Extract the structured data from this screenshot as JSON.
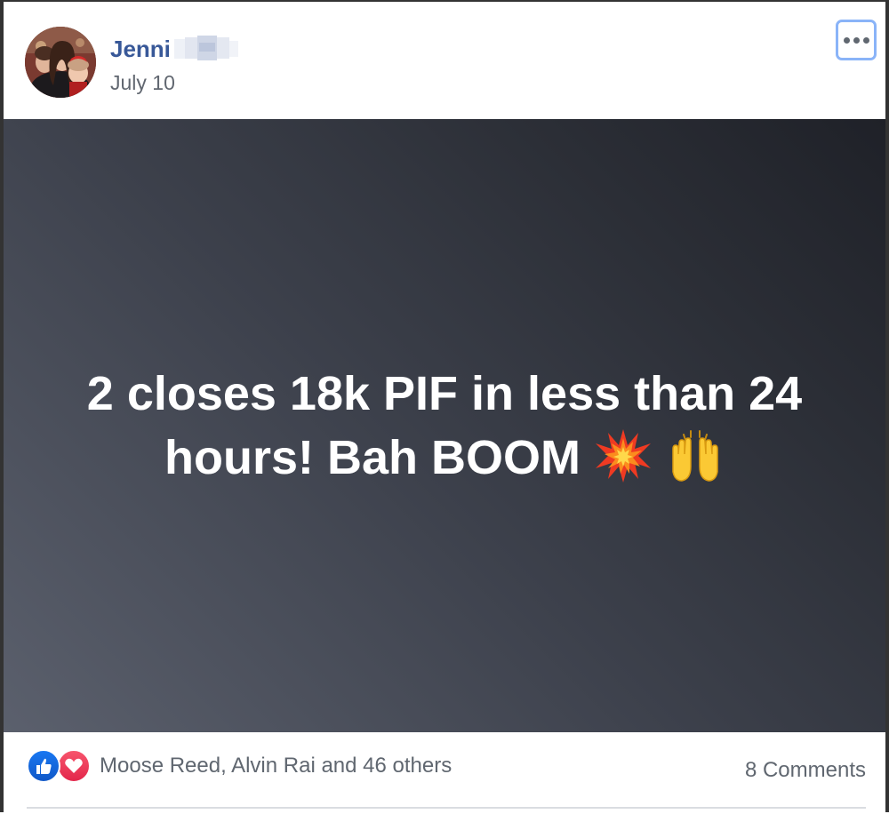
{
  "post": {
    "author_name": "Jenni",
    "date": "July 10",
    "more_options_icon": "more-dots-icon",
    "avatar_icon": "profile-photo",
    "text_line1": "2 closes 18k PIF in less than 24",
    "text_line2": "hours! Bah BOOM",
    "emojis": [
      "collision-emoji",
      "raising-hands-emoji"
    ],
    "background_colors": [
      "#5b606d",
      "#1f2128"
    ]
  },
  "footer": {
    "reaction_icons": [
      "like-icon",
      "love-icon"
    ],
    "reactions_text": "Moose Reed, Alvin Rai and 46 others",
    "comments_text": "8 Comments"
  },
  "colors": {
    "author_link": "#385898",
    "meta_text": "#616770",
    "like_blue": "#1877f2",
    "love_red": "#f33e58",
    "focus_ring": "#8ab4f8"
  }
}
